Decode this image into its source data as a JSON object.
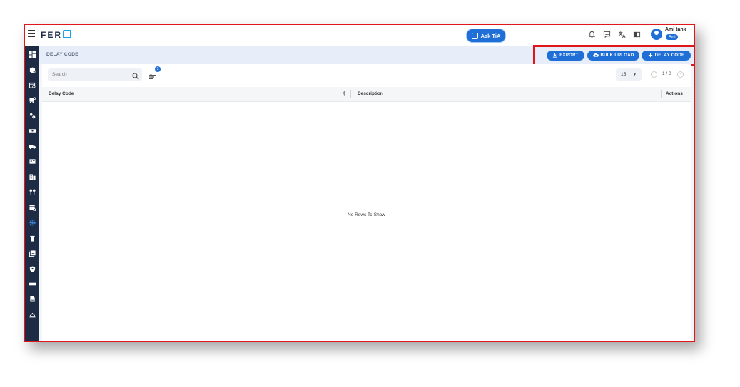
{
  "topbar": {
    "logo": "FER",
    "ask_tia_label": "Ask TiA",
    "user_name": "Ami tank",
    "user_chip": "Ami"
  },
  "page": {
    "title": "DELAY CODE"
  },
  "actions": {
    "export_label": "EXPORT",
    "bulk_upload_label": "BULK UPLOAD",
    "add_label": "DELAY CODE"
  },
  "toolbar": {
    "search_placeholder": "Search",
    "filter_count": "3",
    "page_size": "15",
    "pager_text": "1 / 0"
  },
  "grid": {
    "columns": [
      "Delay Code",
      "Description",
      "Actions"
    ],
    "empty_message": "No Rows To Show"
  },
  "colors": {
    "primary": "#1f6fd6",
    "sidebar": "#1d2b44",
    "highlight": "#e0161b"
  }
}
